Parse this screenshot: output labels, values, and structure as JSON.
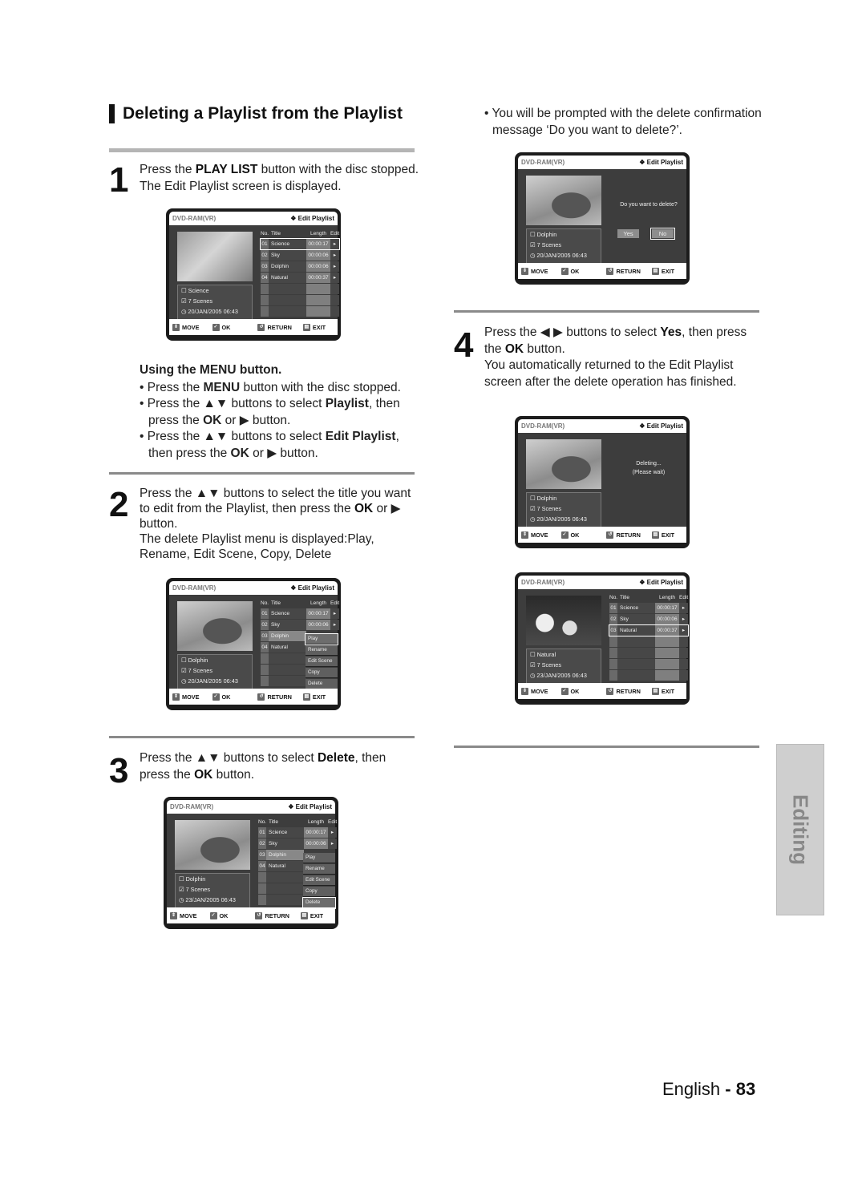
{
  "section_title": "Deleting a Playlist from the Playlist",
  "steps": {
    "s1": {
      "num": "1",
      "l1_a": "Press the ",
      "l1_b": "PLAY LIST",
      "l1_c": " button with the disc stopped.",
      "l2": "The Edit Playlist screen is displayed."
    },
    "menu_tip": {
      "heading": "Using the MENU button.",
      "b1_a": "• Press the ",
      "b1_b": "MENU",
      "b1_c": " button with the disc stopped.",
      "b2_a": "• Press the ▲▼ buttons to select ",
      "b2_b": "Playlist",
      "b2_c": ", then press the ",
      "b2_d": "OK",
      "b2_e": " or ▶ button.",
      "b3_a": "• Press the ▲▼ buttons to select ",
      "b3_b": "Edit Playlist",
      "b3_c": ", then press the ",
      "b3_d": "OK",
      "b3_e": " or ▶ button."
    },
    "s2": {
      "num": "2",
      "a": "Press the ▲▼ buttons to select the title you want to edit from the Playlist, then press the ",
      "b": "OK",
      "c": " or ▶ button.",
      "l2": "The delete Playlist menu is displayed:Play, Rename, Edit Scene, Copy, Delete"
    },
    "s3": {
      "num": "3",
      "a": "Press the ▲▼ buttons to select ",
      "b": "Delete",
      "c": ", then press the ",
      "d": "OK",
      "e": " button."
    },
    "confirm_note": "• You will be prompted with the delete confirmation message ‘Do you want to delete?’.",
    "s4": {
      "num": "4",
      "a": "Press the ◀ ▶ buttons to select ",
      "b": "Yes",
      "c": ", then press the ",
      "d": "OK",
      "e": " button.",
      "l2": "You automatically returned to the Edit Playlist screen after the delete operation has finished."
    }
  },
  "screen_common": {
    "disc": "DVD-RAM(VR)",
    "mode": "❖ Edit Playlist",
    "col_no": "No.",
    "col_title": "Title",
    "col_length": "Length",
    "col_edit": "Edit",
    "footer": {
      "move": "MOVE",
      "ok": "OK",
      "return": "RETURN",
      "exit": "EXIT"
    },
    "scenes": "7 Scenes",
    "edit_arrow": "▸"
  },
  "screens": {
    "s1": {
      "info_title": "Science",
      "date": "20/JAN/2005 06:43",
      "rows": [
        {
          "no": "01",
          "title": "Science",
          "length": "00:00:17"
        },
        {
          "no": "02",
          "title": "Sky",
          "length": "00:00:06"
        },
        {
          "no": "03",
          "title": "Dolphin",
          "length": "00:00:06"
        },
        {
          "no": "04",
          "title": "Natural",
          "length": "00:00:37"
        }
      ]
    },
    "s2": {
      "info_title": "Dolphin",
      "date": "20/JAN/2005 06:43",
      "rows": [
        {
          "no": "01",
          "title": "Science",
          "length": "00:00:17"
        },
        {
          "no": "02",
          "title": "Sky",
          "length": "00:00:06"
        },
        {
          "no": "03",
          "title": "Dolphin"
        },
        {
          "no": "04",
          "title": "Natural"
        }
      ],
      "menu": [
        "Play",
        "Rename",
        "Edit Scene",
        "Copy",
        "Delete"
      ]
    },
    "s3": {
      "info_title": "Dolphin",
      "date": "23/JAN/2005 06:43",
      "rows": [
        {
          "no": "01",
          "title": "Science",
          "length": "00:00:17"
        },
        {
          "no": "02",
          "title": "Sky",
          "length": "00:00:06"
        },
        {
          "no": "03",
          "title": "Dolphin"
        },
        {
          "no": "04",
          "title": "Natural"
        }
      ],
      "menu": [
        "Play",
        "Rename",
        "Edit Scene",
        "Copy",
        "Delete"
      ]
    },
    "confirm": {
      "info_title": "Dolphin",
      "date": "20/JAN/2005 06:43",
      "question": "Do you want to delete?",
      "yes": "Yes",
      "no": "No"
    },
    "deleting": {
      "info_title": "Dolphin",
      "date": "20/JAN/2005 06:43",
      "l1": "Deleting...",
      "l2": "(Please wait)"
    },
    "after": {
      "info_title": "Natural",
      "date": "23/JAN/2005 06:43",
      "rows": [
        {
          "no": "01",
          "title": "Science",
          "length": "00:00:17"
        },
        {
          "no": "02",
          "title": "Sky",
          "length": "00:00:06"
        },
        {
          "no": "03",
          "title": "Natural",
          "length": "00:00:37"
        }
      ]
    }
  },
  "side_tab": "Editing",
  "page": {
    "lang": "English",
    "sep": " - ",
    "num": "83"
  }
}
